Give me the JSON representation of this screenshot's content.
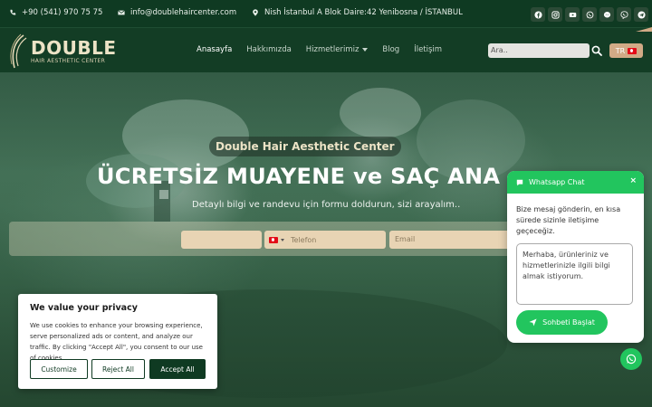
{
  "topbar": {
    "phone": "+90 (541) 970 75 75",
    "email": "info@doublehaircenter.com",
    "address": "Nish İstanbul A Blok Daire:42 Yenibosna / İSTANBUL",
    "socials": [
      "facebook-icon",
      "instagram-icon",
      "youtube-icon",
      "whatsapp-icon",
      "messenger-icon",
      "viber-icon",
      "telegram-icon"
    ]
  },
  "logo": {
    "word": "DOUBLE",
    "tagline": "HAIR AESTHETIC CENTER"
  },
  "nav": {
    "items": [
      "Anasayfa",
      "Hakkımızda",
      "Hizmetlerimiz",
      "Blog",
      "İletişim"
    ],
    "active": "Anasayfa",
    "search_placeholder": "Ara..",
    "lang": "TR"
  },
  "hero": {
    "badge": "Double Hair Aesthetic Center",
    "headline": "ÜCRETSİZ MUAYENE ve SAÇ ANA",
    "subtitle": "Detaylı bilgi ve randevu için formu doldurun, sizi arayalım..",
    "phone_placeholder": "Telefon",
    "email_placeholder": "Email"
  },
  "cookie": {
    "title": "We value your privacy",
    "text": "We use cookies to enhance your browsing experience, serve personalized ads or content, and analyze our traffic. By clicking \"Accept All\", you consent to our use of cookies.",
    "customize": "Customize",
    "reject": "Reject All",
    "accept": "Accept All"
  },
  "whatsapp": {
    "title": "Whatsapp Chat",
    "close": "×",
    "intro": "Bize mesaj gönderin, en kısa sürede sizinle iletişime geçeceğiz.",
    "message": "Merhaba, ürünleriniz ve hizmetlerinizle ilgili bilgi almak istiyorum.",
    "button": "Sohbeti Başlat"
  },
  "colors": {
    "brand_dark": "#0f3a22",
    "accent_tan": "#d2aa86",
    "whatsapp_green": "#22c55e"
  }
}
